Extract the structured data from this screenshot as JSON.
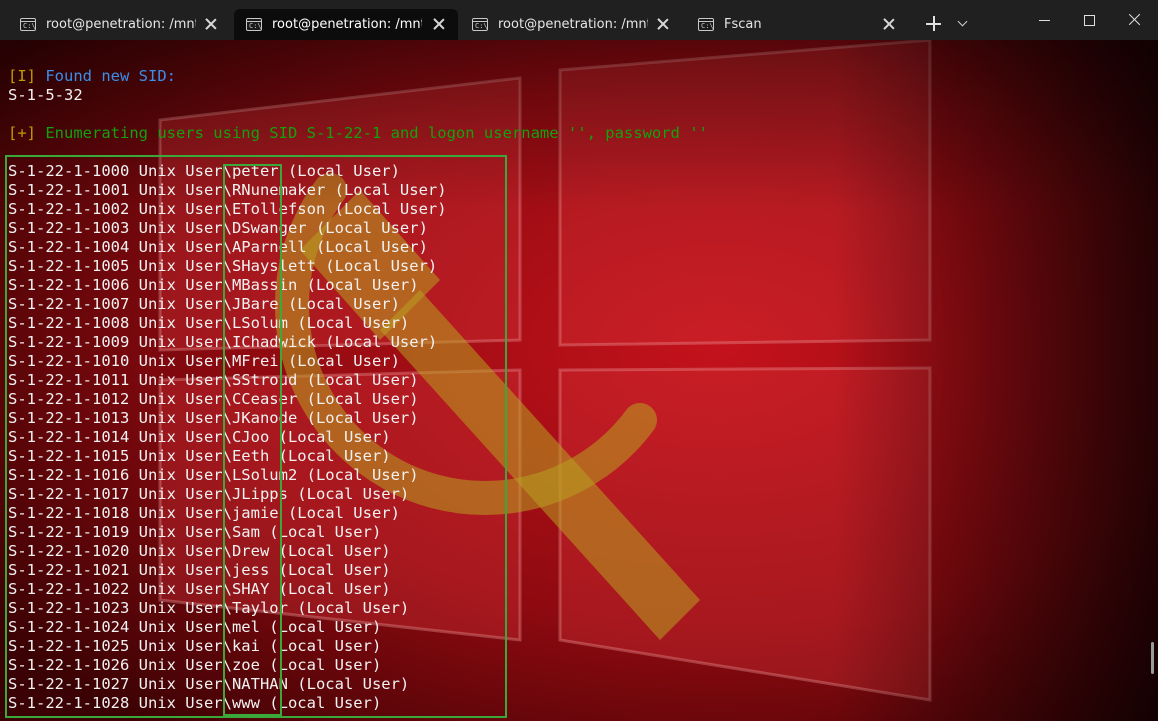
{
  "tabs": [
    {
      "title": "root@penetration: /mnt/c/U",
      "active": false,
      "icon": "terminal-icon",
      "icon_glyph": "C:\\"
    },
    {
      "title": "root@penetration: /mnt/c/U",
      "active": true,
      "icon": "terminal-icon",
      "icon_glyph": "C:\\"
    },
    {
      "title": "root@penetration: /mnt/c/U",
      "active": false,
      "icon": "terminal-icon",
      "icon_glyph": "C:\\"
    },
    {
      "title": "Fscan",
      "active": false,
      "icon": "cmd-icon",
      "icon_glyph": "C:\\"
    }
  ],
  "colors": {
    "tabbar": "#202020",
    "active_tab": "#0c0c0c",
    "info_blue": "#3b8eea",
    "success_green": "#13a10e",
    "prefix_yellow": "#c19c00",
    "highlight_box": "#3aa83a",
    "background_red": "#8b0000"
  },
  "terminal": {
    "info_prefix": "[I]",
    "info_text": " Found new SID:",
    "sid_value": "S-1-5-32",
    "enum_prefix": "[+]",
    "enum_text": " Enumerating users using SID S-1-22-1 and logon username '', password ''",
    "user_lines": [
      "S-1-22-1-1000 Unix User\\peter (Local User)",
      "S-1-22-1-1001 Unix User\\RNunemaker (Local User)",
      "S-1-22-1-1002 Unix User\\ETollefson (Local User)",
      "S-1-22-1-1003 Unix User\\DSwanger (Local User)",
      "S-1-22-1-1004 Unix User\\AParnell (Local User)",
      "S-1-22-1-1005 Unix User\\SHayslett (Local User)",
      "S-1-22-1-1006 Unix User\\MBassin (Local User)",
      "S-1-22-1-1007 Unix User\\JBare (Local User)",
      "S-1-22-1-1008 Unix User\\LSolum (Local User)",
      "S-1-22-1-1009 Unix User\\IChadwick (Local User)",
      "S-1-22-1-1010 Unix User\\MFrei (Local User)",
      "S-1-22-1-1011 Unix User\\SStroud (Local User)",
      "S-1-22-1-1012 Unix User\\CCeaser (Local User)",
      "S-1-22-1-1013 Unix User\\JKanode (Local User)",
      "S-1-22-1-1014 Unix User\\CJoo (Local User)",
      "S-1-22-1-1015 Unix User\\Eeth (Local User)",
      "S-1-22-1-1016 Unix User\\LSolum2 (Local User)",
      "S-1-22-1-1017 Unix User\\JLipps (Local User)",
      "S-1-22-1-1018 Unix User\\jamie (Local User)",
      "S-1-22-1-1019 Unix User\\Sam (Local User)",
      "S-1-22-1-1020 Unix User\\Drew (Local User)",
      "S-1-22-1-1021 Unix User\\jess (Local User)",
      "S-1-22-1-1022 Unix User\\SHAY (Local User)",
      "S-1-22-1-1023 Unix User\\Taylor (Local User)",
      "S-1-22-1-1024 Unix User\\mel (Local User)",
      "S-1-22-1-1025 Unix User\\kai (Local User)",
      "S-1-22-1-1026 Unix User\\zoe (Local User)",
      "S-1-22-1-1027 Unix User\\NATHAN (Local User)",
      "S-1-22-1-1028 Unix User\\www (Local User)"
    ]
  }
}
